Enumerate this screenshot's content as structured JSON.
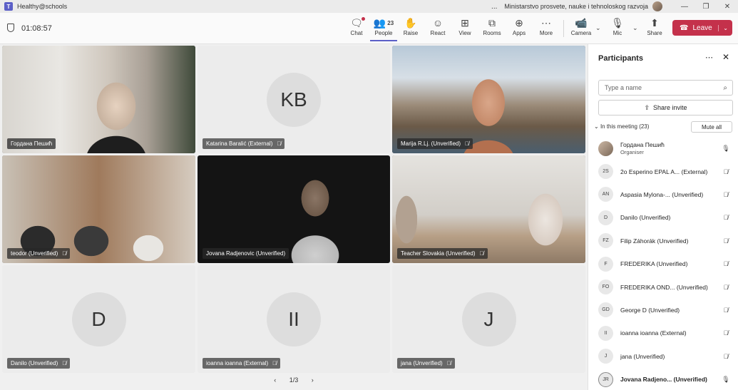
{
  "titlebar": {
    "app_name": "Healthy@schools",
    "more": "...",
    "org": "Ministarstvo prosvete, nauke i tehnoloskog razvoja"
  },
  "toolbar": {
    "timer": "01:08:57",
    "items": [
      {
        "label": "Chat",
        "icon": "chat-icon"
      },
      {
        "label": "People",
        "icon": "people-icon",
        "count": "23"
      },
      {
        "label": "Raise",
        "icon": "hand-icon"
      },
      {
        "label": "React",
        "icon": "smiley-icon"
      },
      {
        "label": "View",
        "icon": "grid-icon"
      },
      {
        "label": "Rooms",
        "icon": "rooms-icon"
      },
      {
        "label": "Apps",
        "icon": "plus-icon"
      },
      {
        "label": "More",
        "icon": "more-icon"
      },
      {
        "label": "Camera",
        "icon": "camera-icon"
      },
      {
        "label": "Mic",
        "icon": "mic-icon"
      },
      {
        "label": "Share",
        "icon": "share-icon"
      }
    ],
    "leave_label": "Leave",
    "leave_color": "#c4314b",
    "accent_color": "#5b5fc7"
  },
  "tiles": [
    {
      "name": "Гордана Пешић",
      "type": "video"
    },
    {
      "name": "Katarina Baralić (External)",
      "type": "blank",
      "initials": "KB"
    },
    {
      "name": "Marija R.Lj. (Unverified)",
      "type": "video"
    },
    {
      "name": "teodor (Unverified)",
      "type": "video"
    },
    {
      "name": "Jovana Radjenovic (Unverified)",
      "type": "video"
    },
    {
      "name": "Teacher Slovakia (Unverified)",
      "type": "video"
    },
    {
      "name": "Danilo (Unverified)",
      "type": "blank",
      "initials": "D"
    },
    {
      "name": "ioanna ioanna (External)",
      "type": "blank",
      "initials": "II"
    },
    {
      "name": "jana (Unverified)",
      "type": "blank",
      "initials": "J"
    }
  ],
  "pager": {
    "current": "1/3"
  },
  "panel": {
    "title": "Participants",
    "search_placeholder": "Type a name",
    "share_invite": "Share invite",
    "section_label": "In this meeting (23)",
    "mute_all": "Mute all",
    "participants": [
      {
        "initials": "",
        "name": "Гордана Пешић",
        "role": "Organiser",
        "mic": "on"
      },
      {
        "initials": "2S",
        "name": "2o Esperino EPAL A... (External)",
        "mic": "muted"
      },
      {
        "initials": "AN",
        "name": "Aspasia Mylona-... (Unverified)",
        "mic": "muted"
      },
      {
        "initials": "D",
        "name": "Danilo (Unverified)",
        "mic": "muted"
      },
      {
        "initials": "FZ",
        "name": "Filip Záhorák (Unverified)",
        "mic": "muted"
      },
      {
        "initials": "F",
        "name": "FREDERIKA (Unverified)",
        "mic": "muted"
      },
      {
        "initials": "FO",
        "name": "FREDERIKA OND... (Unverified)",
        "mic": "muted"
      },
      {
        "initials": "GD",
        "name": "George D (Unverified)",
        "mic": "muted"
      },
      {
        "initials": "II",
        "name": "ioanna ioanna (External)",
        "mic": "muted"
      },
      {
        "initials": "J",
        "name": "jana (Unverified)",
        "mic": "muted"
      },
      {
        "initials": "JR",
        "name": "Jovana Radjeno... (Unverified)",
        "mic": "on"
      }
    ]
  }
}
